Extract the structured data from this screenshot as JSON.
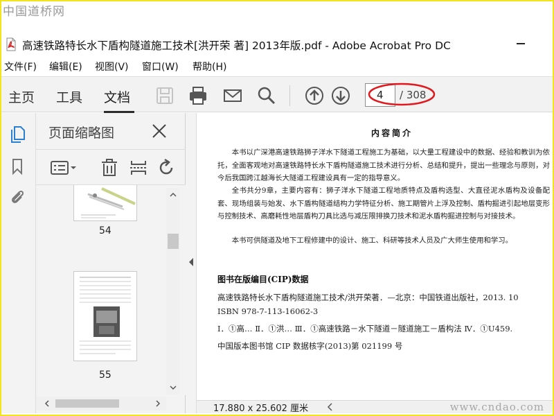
{
  "watermark": {
    "top": "中国道桥网",
    "bottom": "www.cndao.com"
  },
  "window": {
    "title": "高速铁路特长水下盾构隧道施工技术[洪开荣 著] 2013年版.pdf - Adobe Acrobat Pro DC"
  },
  "menu": [
    "文件(F)",
    "编辑(E)",
    "视图(V)",
    "窗口(W)",
    "帮助(H)"
  ],
  "toolbar": {
    "tabs": [
      "主页",
      "工具",
      "文档"
    ],
    "active_tab": "文档",
    "icons": [
      "save-icon",
      "print-icon",
      "email-icon",
      "search-icon",
      "page-up-icon",
      "page-down-icon"
    ],
    "current_page": "4",
    "total_pages": "/ 308"
  },
  "sidebar_icons": [
    "page-thumbnails-icon",
    "bookmark-icon",
    "attachment-icon"
  ],
  "thumbnail_panel": {
    "title": "页面缩略图",
    "tools": [
      "options-menu-icon",
      "delete-icon",
      "crop-pages-icon",
      "rotate-icon"
    ],
    "pages": [
      {
        "label": "54"
      },
      {
        "label": "55"
      }
    ]
  },
  "document": {
    "heading": "内容简介",
    "paragraphs": [
      "本书以广深港高速铁路狮子洋水下隧道工程施工为基础，以大量工程建设中的数据、经验和教训为依托，全面客观地对高速铁路特长水下盾构隧道施工技术进行分析、总结和提升，提出一些理念与原则，对今后我国跨江越海长大隧道工程建设具有一定的指导意义。",
      "全书共分9章，主要内容有：狮子洋水下隧道工程地质特点及盾构选型、大直径泥水盾构及设备配套、现场组装与始发、水下盾构隧道结构力学特征分析、施工期管片上浮及控制、盾构掘进引起地层变形与控制技术、高磨耗性地层盾构刀具比选与减压限排换刀技术和泥水盾构掘进控制与对接技术。",
      "本书可供隧道及地下工程修建中的设计、施工、科研等技术人员及广大师生使用和学习。"
    ],
    "cip_title": "图书在版编目(CIP)数据",
    "cip_lines": [
      "高速铁路特长水下盾构隧道施工技术/洪开荣著．—北京：中国铁道出版社，2013. 10",
      "ISBN 978-7-113-16062-3",
      "Ⅰ．①高…  Ⅱ．①洪…  Ⅲ．①高速铁路－水下隧道－隧道施工－盾构法   Ⅳ．①U459.",
      "中国版本图书馆 CIP 数据核字(2013)第 021199 号"
    ]
  },
  "status": {
    "page_size": "17.880 x 25.602 厘米"
  },
  "colors": {
    "frame": "#f2e51e",
    "annotation": "#e0191f",
    "pdf_icon": "#d42a2a"
  }
}
